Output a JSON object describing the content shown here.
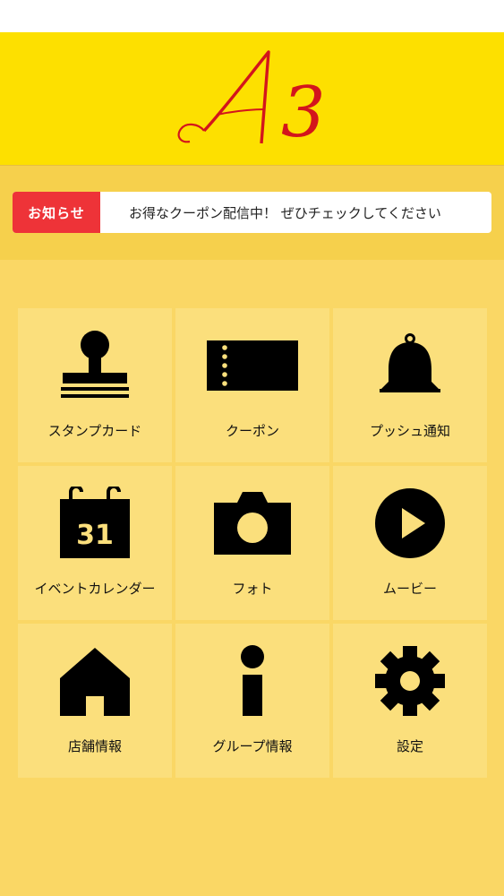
{
  "app": {
    "logo_text": "A3"
  },
  "news": {
    "label": "お知らせ",
    "message": "お得なクーポン配信中！ ぜひチェックしてください"
  },
  "menu": {
    "items": [
      {
        "label": "スタンプカード",
        "icon": "stamp-icon"
      },
      {
        "label": "クーポン",
        "icon": "ticket-icon"
      },
      {
        "label": "プッシュ通知",
        "icon": "bell-icon"
      },
      {
        "label": "イベントカレンダー",
        "icon": "calendar-icon",
        "icon_text": "31"
      },
      {
        "label": "フォト",
        "icon": "camera-icon"
      },
      {
        "label": "ムービー",
        "icon": "play-icon"
      },
      {
        "label": "店舗情報",
        "icon": "house-icon"
      },
      {
        "label": "グループ情報",
        "icon": "info-icon"
      },
      {
        "label": "設定",
        "icon": "gear-icon"
      }
    ]
  },
  "colors": {
    "header_bg": "#fde000",
    "logo_red": "#d3151c",
    "news_bar_bg": "#f6d04c",
    "news_label_bg": "#ee3338",
    "menu_bg": "#fad765",
    "tile_bg": "#fbdf7c",
    "icon": "#000000"
  }
}
